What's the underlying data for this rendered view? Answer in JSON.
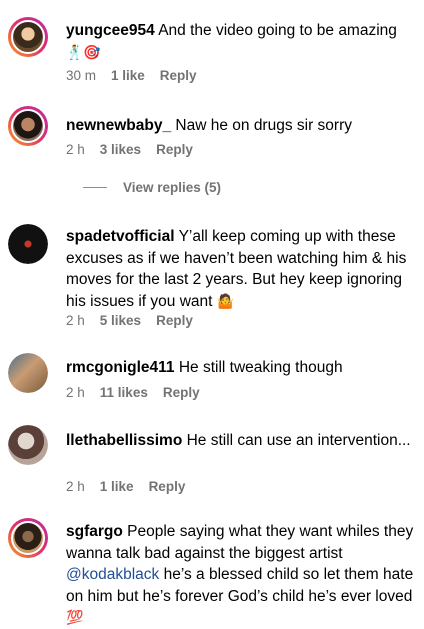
{
  "comments": [
    {
      "username": "yungcee954",
      "text": "And the video going to be amazing",
      "emoji": "🕺🎯",
      "time": "30 m",
      "likes": "1 like",
      "reply": "Reply"
    },
    {
      "username": "newnewbaby_",
      "text": "Naw he on drugs sir sorry",
      "time": "2 h",
      "likes": "3 likes",
      "reply": "Reply",
      "view_replies": "View replies (5)"
    },
    {
      "username": "spadetvofficial",
      "text": "Y’all keep coming up with these excuses as if we haven’t been watching him & his moves for the last 2 years. But hey keep ignoring his issues if you want",
      "emoji": "🤷",
      "time": "2 h",
      "likes": "5 likes",
      "reply": "Reply"
    },
    {
      "username": "rmcgonigle411",
      "text": "He still tweaking though",
      "time": "2 h",
      "likes": "11 likes",
      "reply": "Reply"
    },
    {
      "username": "llethabellissimo",
      "text": "He still can use an intervention...",
      "time": "2 h",
      "likes": "1 like",
      "reply": "Reply"
    },
    {
      "username": "sgfargo",
      "text_before_mention": "People saying what they want whiles they wanna talk bad against the biggest artist",
      "mention": "@kodakblack",
      "text_after_mention": "he’s a blessed child so let them hate on him but he’s forever God’s child he’s ever loved",
      "emoji": "💯"
    }
  ],
  "colors": {
    "meta_text": "#737373",
    "mention": "#1f4e97",
    "story_ring": "#e1306c"
  }
}
